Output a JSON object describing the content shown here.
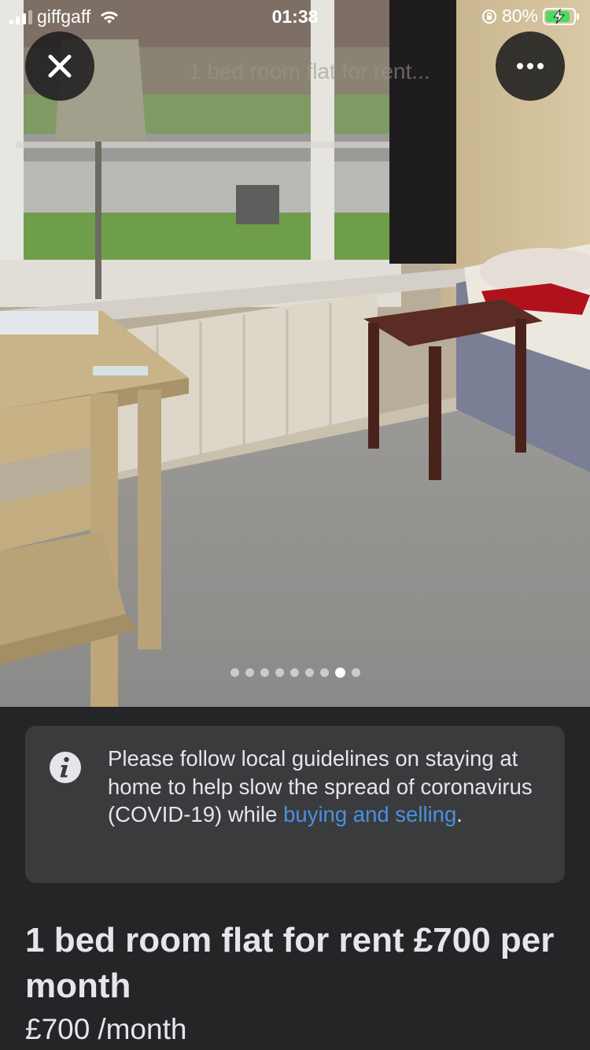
{
  "status_bar": {
    "carrier": "giffgaff",
    "time": "01:38",
    "battery": "80%",
    "icons": [
      "signal-icon",
      "wifi-icon",
      "orientation-lock-icon",
      "battery-charging-icon"
    ]
  },
  "viewer": {
    "close_icon": "close-icon",
    "more_icon": "more-icon",
    "photo_count": 9,
    "active_photo_index": 8
  },
  "notice": {
    "icon": "info-icon",
    "text": "Please follow local guidelines on staying at home to help slow the spread of coronavirus (COVID-19) while ",
    "link_text": "buying and selling",
    "end": "."
  },
  "listing": {
    "title": "1 bed room flat for rent £700 per month",
    "price": "£700",
    "price_unit": "/month"
  },
  "colors": {
    "background": "#242526",
    "card": "#3a3b3c",
    "link": "#4a90e2",
    "text": "#e4e6eb"
  }
}
